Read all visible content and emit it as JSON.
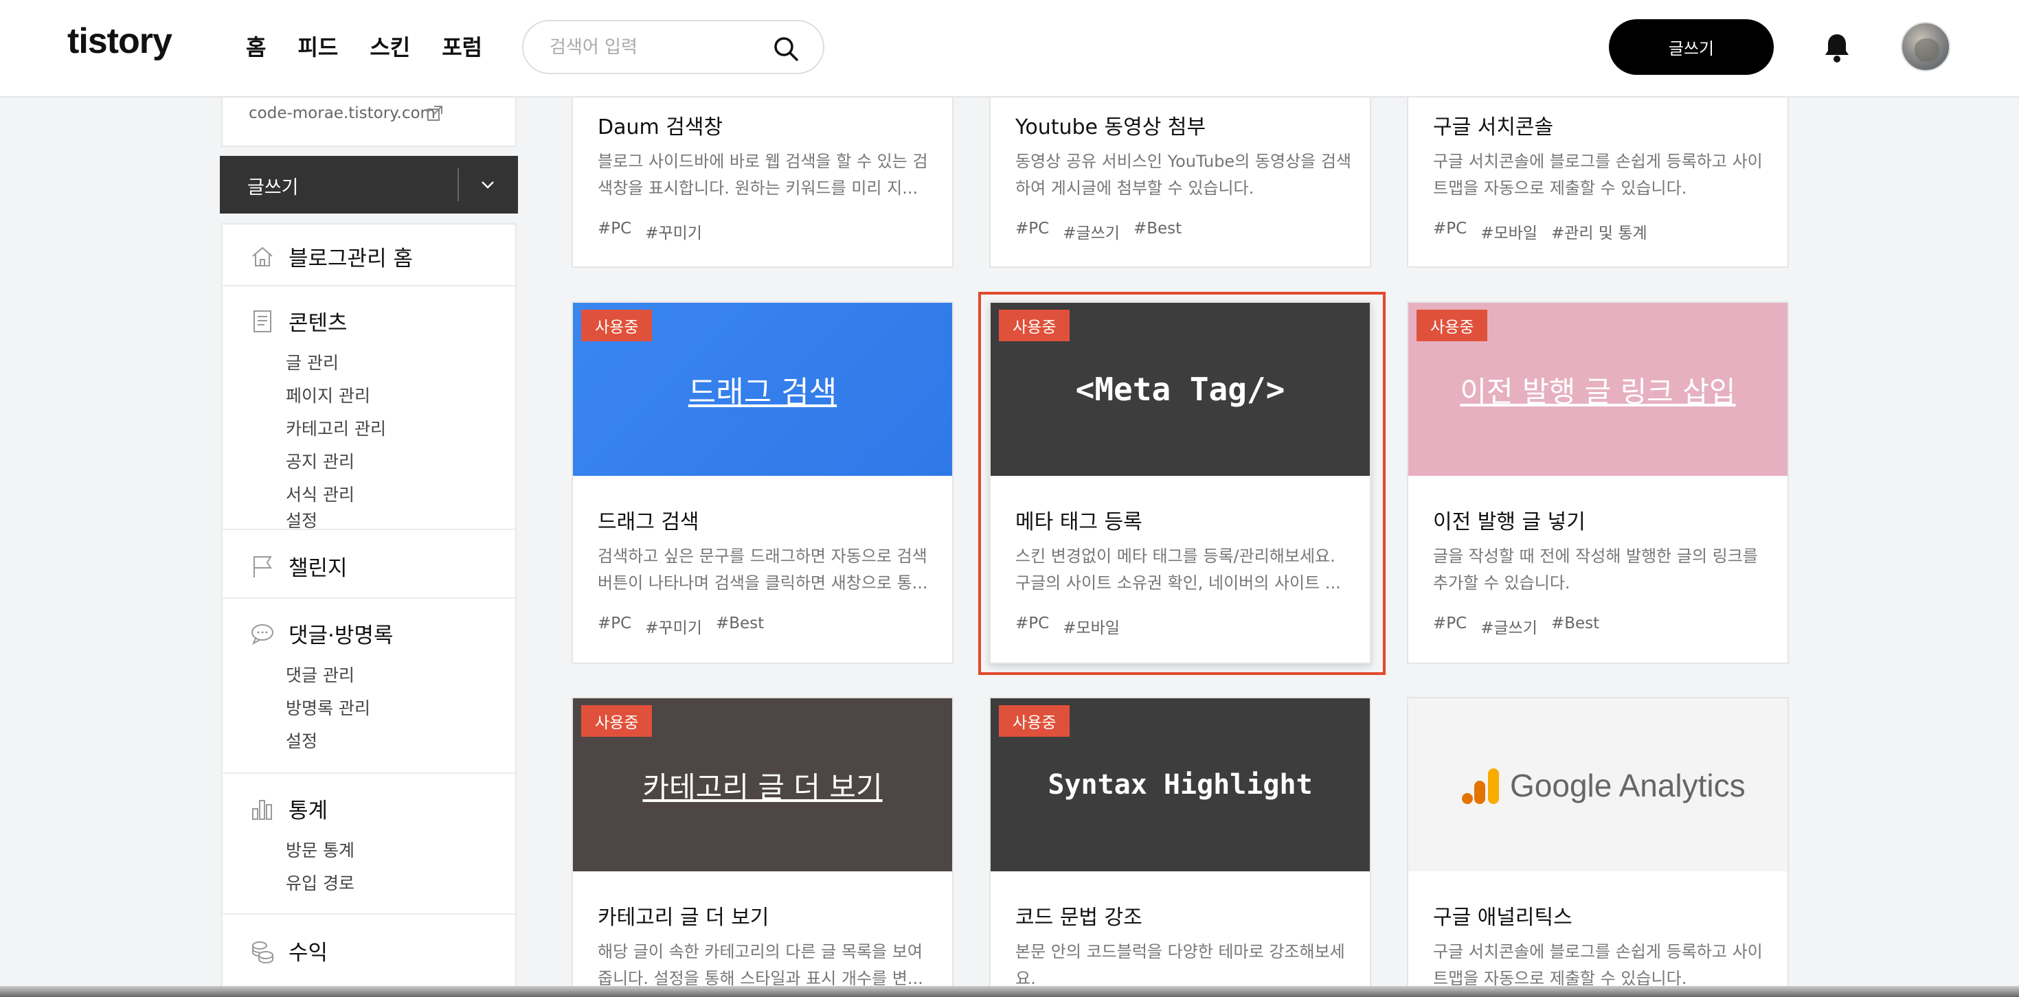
{
  "header": {
    "logo": "tistory",
    "nav": [
      "홈",
      "피드",
      "스킨",
      "포럼"
    ],
    "search_placeholder": "검색어 입력",
    "write_label": "글쓰기"
  },
  "sidebar": {
    "url": "code-morae.tistory.com",
    "write_label": "글쓰기",
    "home": "블로그관리 홈",
    "contents": {
      "label": "콘텐츠",
      "items": [
        "글 관리",
        "페이지 관리",
        "카테고리 관리",
        "공지 관리",
        "서식 관리",
        "설정"
      ]
    },
    "challenge": "챌린지",
    "comments": {
      "label": "댓글·방명록",
      "items": [
        "댓글 관리",
        "방명록 관리",
        "설정"
      ]
    },
    "stats": {
      "label": "통계",
      "items": [
        "방문 통계",
        "유입 경로"
      ]
    },
    "revenue": "수익"
  },
  "plugins": [
    {
      "title": "Daum 검색창",
      "desc": "블로그 사이드바에 바로 웹 검색을 할 수 있는 검색창을 표시합니다. 원하는 키워드를 미리 지...",
      "tags": [
        "#PC",
        "#꾸미기"
      ]
    },
    {
      "title": "Youtube 동영상 첨부",
      "desc": "동영상 공유 서비스인 YouTube의 동영상을 검색하여 게시글에 첨부할 수 있습니다.",
      "tags": [
        "#PC",
        "#글쓰기",
        "#Best"
      ]
    },
    {
      "title": "구글 서치콘솔",
      "desc": "구글 서치콘솔에 블로그를 손쉽게 등록하고 사이트맵을 자동으로 제출할 수 있습니다.",
      "tags": [
        "#PC",
        "#모바일",
        "#관리 및 통계"
      ]
    },
    {
      "badge": "사용중",
      "thumb": "드래그 검색",
      "title": "드래그 검색",
      "desc": "검색하고 싶은 문구를 드래그하면 자동으로 검색 버튼이 나타나며 검색을 클릭하면 새창으로 통...",
      "tags": [
        "#PC",
        "#꾸미기",
        "#Best"
      ]
    },
    {
      "badge": "사용중",
      "thumb": "<Meta Tag/>",
      "title": "메타 태그 등록",
      "desc": "스킨 변경없이 메타 태그를 등록/관리해보세요. 구글의 사이트 소유권 확인, 네이버의 사이트 ...",
      "tags": [
        "#PC",
        "#모바일"
      ]
    },
    {
      "badge": "사용중",
      "thumb": "이전 발행 글 링크 삽입",
      "title": "이전 발행 글 넣기",
      "desc": "글을 작성할 때 전에 작성해 발행한 글의 링크를 추가할 수 있습니다.",
      "tags": [
        "#PC",
        "#글쓰기",
        "#Best"
      ]
    },
    {
      "badge": "사용중",
      "thumb": "카테고리 글 더 보기",
      "title": "카테고리 글 더 보기",
      "desc": "해당 글이 속한 카테고리의 다른 글 목록을 보여줍니다. 설정을 통해 스타일과 표시 개수를 변...",
      "tags": []
    },
    {
      "badge": "사용중",
      "thumb": "Syntax Highlight",
      "title": "코드 문법 강조",
      "desc": "본문 안의 코드블럭을 다양한 테마로 강조해보세요.",
      "tags": []
    },
    {
      "thumb": "Google Analytics",
      "title": "구글 애널리틱스",
      "desc": "구글 서치콘솔에 블로그를 손쉽게 등록하고 사이트맵을 자동으로 제출할 수 있습니다.",
      "tags": []
    }
  ],
  "colors": {
    "accent": "#e0513b",
    "highlight": "#e04a2c",
    "blue_thumb": "#3a86f0",
    "dark_thumb": "#3d3d3d",
    "pink_thumb": "#e6b0c0",
    "brown_thumb": "#4d4644"
  }
}
